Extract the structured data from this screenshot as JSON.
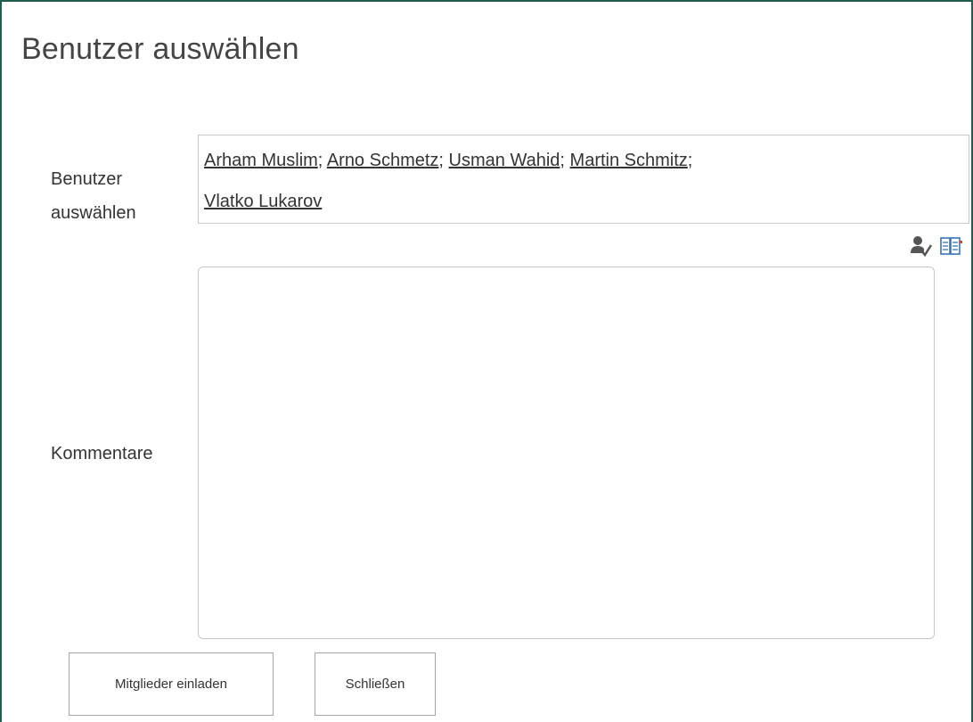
{
  "dialog": {
    "title": "Benutzer auswählen"
  },
  "form": {
    "users_label": "Benutzer auswählen",
    "comments_label": "Kommentare",
    "selected_users": [
      "Arham Muslim",
      "Arno Schmetz",
      "Usman Wahid",
      "Martin Schmitz",
      "Vlatko Lukarov"
    ],
    "separator": ";",
    "icons": [
      "check-names-icon",
      "browse-address-book-icon"
    ],
    "comments_value": ""
  },
  "buttons": {
    "invite_label": "Mitglieder einladen",
    "close_label": "Schließen"
  }
}
